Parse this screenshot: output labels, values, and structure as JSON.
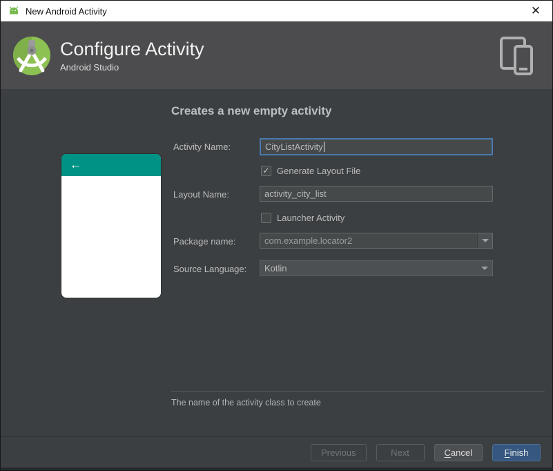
{
  "window": {
    "title": "New Android Activity",
    "close_glyph": "✕"
  },
  "header": {
    "title": "Configure Activity",
    "subtitle": "Android Studio"
  },
  "main": {
    "heading": "Creates a new empty activity",
    "preview": {
      "back_glyph": "←"
    },
    "form": {
      "activity_name": {
        "label": "Activity Name:",
        "value": "CityListActivity"
      },
      "generate_layout": {
        "label": "Generate Layout File",
        "checked": true,
        "mark": "✓"
      },
      "layout_name": {
        "label": "Layout Name:",
        "value": "activity_city_list"
      },
      "launcher_activity": {
        "label": "Launcher Activity",
        "checked": false,
        "mark": ""
      },
      "package_name": {
        "label": "Package name:",
        "value": "com.example.locator2"
      },
      "source_language": {
        "label": "Source Language:",
        "value": "Kotlin"
      }
    },
    "hint": "The name of the activity class to create"
  },
  "footer": {
    "previous_label": "Previous",
    "next_label": "Next",
    "cancel_mnemonic": "C",
    "cancel_rest": "ancel",
    "finish_mnemonic": "F",
    "finish_rest": "inish"
  },
  "colors": {
    "accent_blue": "#365880",
    "focus_border": "#4a7ab0",
    "preview_teal": "#009284",
    "header_gray": "#4c4c4e",
    "body_gray": "#3b3f42",
    "logo_green": "#8dc153"
  }
}
